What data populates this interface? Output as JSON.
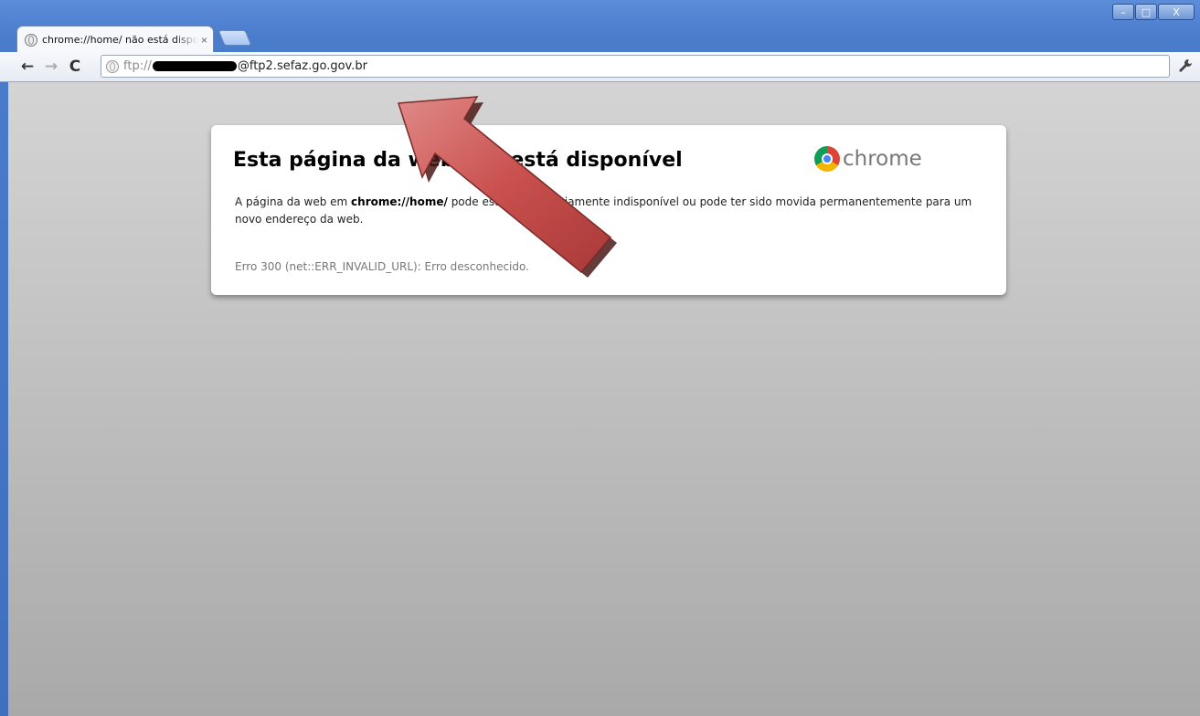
{
  "window": {
    "controls": [
      "–",
      "□",
      "X"
    ]
  },
  "tab": {
    "title": "chrome://home/ não está disponível",
    "close": "×"
  },
  "toolbar": {
    "back": "←",
    "forward": "→",
    "reload": "C",
    "url_scheme": "ftp://",
    "url_host": "@ftp2.sefaz.go.gov.br",
    "wrench": "🔧"
  },
  "error": {
    "title": "Esta página da web não está disponível",
    "brand": "chrome",
    "desc_before": "A página da web em ",
    "desc_url": "chrome://home/",
    "desc_after": " pode estar temporariamente indisponível ou pode ter sido movida permanentemente para um novo endereço da web.",
    "code": "Erro 300 (net::ERR_INVALID_URL): Erro desconhecido."
  },
  "colors": {
    "arrow": "#c9504e",
    "title_bar": "#4a7ccc"
  }
}
